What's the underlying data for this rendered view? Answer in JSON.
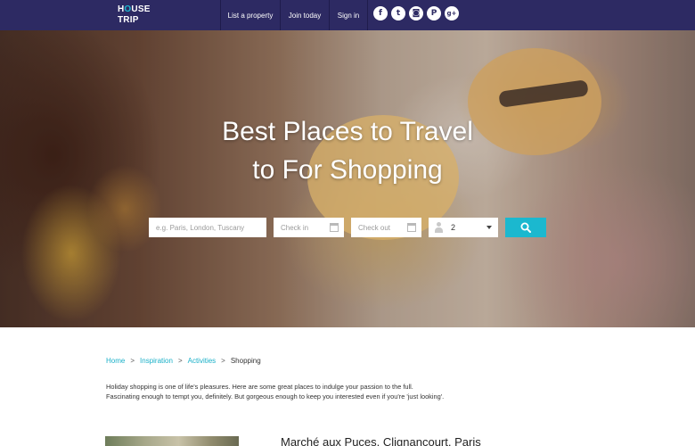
{
  "header": {
    "logo_line1_a": "H",
    "logo_line1_o": "O",
    "logo_line1_b": "USE",
    "logo_line2": "TRIP",
    "nav": {
      "list_property": "List a property",
      "join_today": "Join today",
      "sign_in": "Sign in"
    },
    "social": [
      {
        "icon": "facebook-icon",
        "glyph": "f"
      },
      {
        "icon": "twitter-icon",
        "glyph": "t"
      },
      {
        "icon": "instagram-icon",
        "glyph": "◙"
      },
      {
        "icon": "pinterest-icon",
        "glyph": "P"
      },
      {
        "icon": "google-plus-icon",
        "glyph": "g+"
      }
    ]
  },
  "hero": {
    "title_line1": "Best Places to Travel",
    "title_line2": "to For Shopping",
    "search": {
      "destination_placeholder": "e.g. Paris, London, Tuscany",
      "checkin_placeholder": "Check in",
      "checkout_placeholder": "Check out",
      "guests_value": "2"
    }
  },
  "breadcrumb": {
    "home": "Home",
    "inspiration": "Inspiration",
    "activities": "Activities",
    "current": "Shopping",
    "separator": ">"
  },
  "intro": {
    "line1": "Holiday shopping is one of life's pleasures. Here are some great places to indulge your passion to the full.",
    "line2": "Fascinating enough to tempt you, definitely. But gorgeous enough to keep you interested even if you're 'just looking'."
  },
  "section": {
    "first_title": "Marché aux Puces, Clignancourt, Paris"
  },
  "colors": {
    "header_bg": "#2d2a63",
    "accent": "#1bb8cf",
    "link": "#1ab0c8"
  }
}
